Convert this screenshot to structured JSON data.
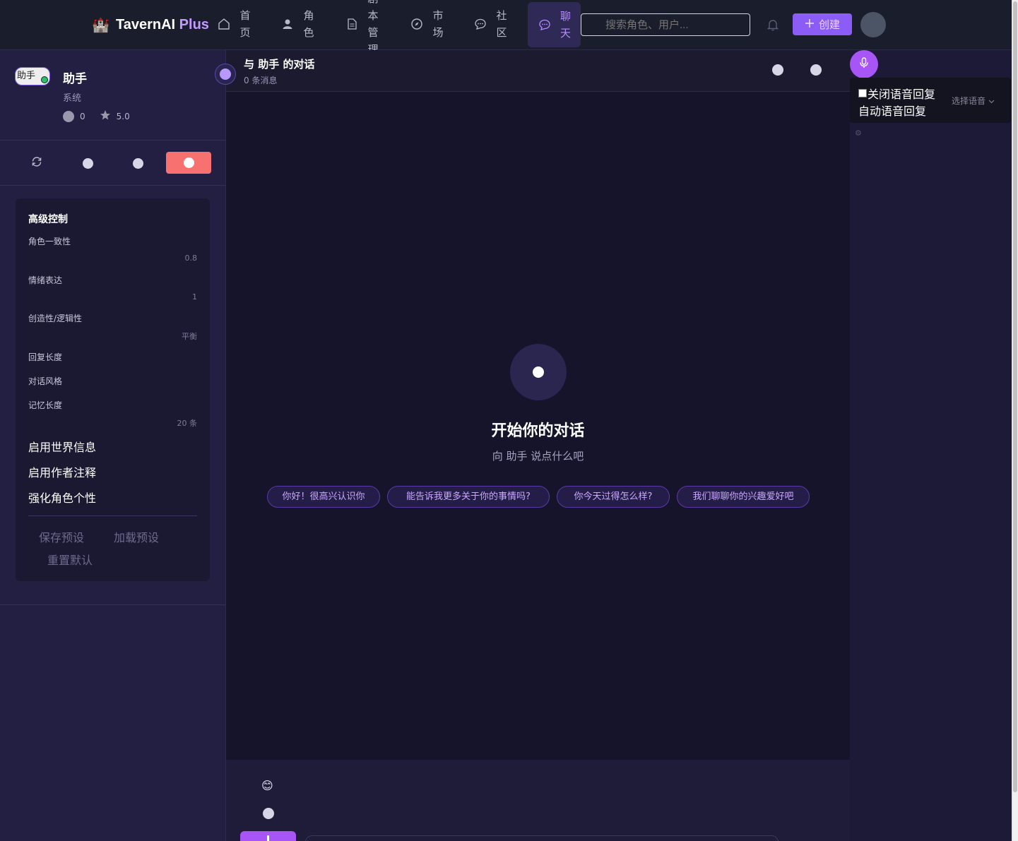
{
  "nav": {
    "brand_main": "TavernAI ",
    "brand_plus": "Plus",
    "items": [
      {
        "label": "首页",
        "icon": "home-icon"
      },
      {
        "label": "角色",
        "icon": "user-icon"
      },
      {
        "label": "剧本管理",
        "icon": "document-icon"
      },
      {
        "label": "市场",
        "icon": "compass-icon"
      },
      {
        "label": "社区",
        "icon": "chat-bubble-icon"
      },
      {
        "label": "聊天",
        "icon": "chat-bubble-icon",
        "active": true
      }
    ],
    "search_placeholder": "搜索角色、用户...",
    "create_label": "创建",
    "accent": "#8b5cf6"
  },
  "character": {
    "avatar_alt": "助手",
    "name": "助手",
    "subtitle": "系统",
    "stat_count": "0",
    "rating": "5.0"
  },
  "advanced": {
    "title": "高级控制",
    "consistency_label": "角色一致性",
    "consistency_value": "0.8",
    "emotion_label": "情绪表达",
    "emotion_value": "1",
    "creativity_label": "创造性/逻辑性",
    "creativity_value": "平衡",
    "reply_length_label": "回复长度",
    "style_label": "对话风格",
    "memory_label": "记忆长度",
    "memory_value": "20 条",
    "world_info_label": "启用世界信息",
    "author_note_label": "启用作者注释",
    "personality_label": "强化角色个性",
    "save_preset": "保存预设",
    "load_preset": "加载预设",
    "reset_default": "重置默认"
  },
  "chat": {
    "title": "与 助手 的对话",
    "message_count": "0 条消息",
    "empty_title": "开始你的对话",
    "empty_subtitle": "向 助手 说点什么吧",
    "suggestions": [
      "你好！很高兴认识你",
      "能告诉我更多关于你的事情吗?",
      "你今天过得怎么样?",
      "我们聊聊你的兴趣爱好吧"
    ],
    "emoji": "😊"
  },
  "voice": {
    "disable_label": "关闭语音回复",
    "auto_label": "自动语音回复",
    "select_voice": "选择语音"
  }
}
